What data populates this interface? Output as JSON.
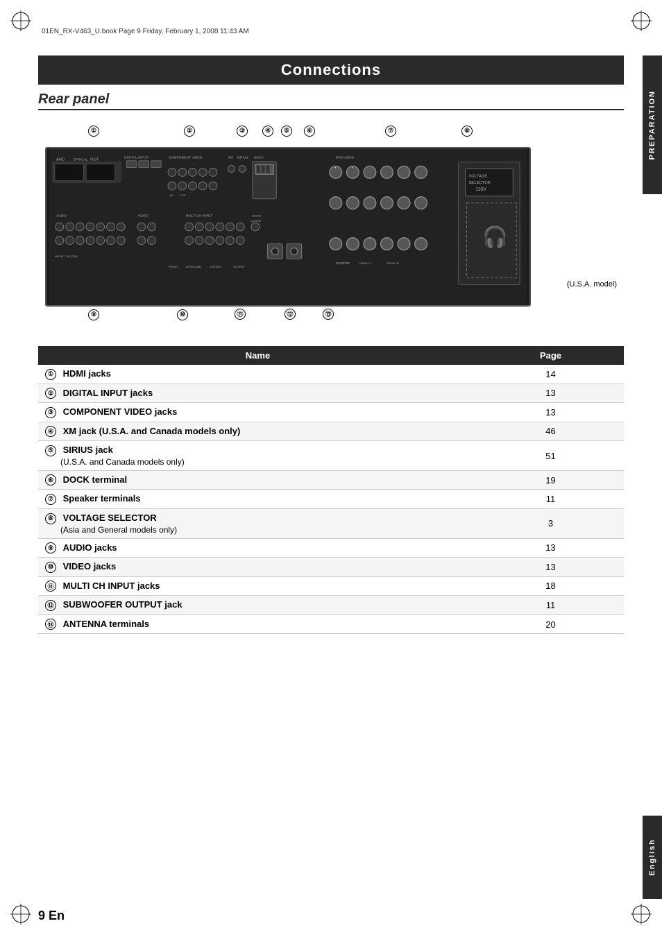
{
  "file_info": "01EN_RX-V463_U.book  Page 9  Friday, February 1, 2008  11:43 AM",
  "title": "Connections",
  "section": "Rear panel",
  "us_model_label": "(U.S.A. model)",
  "page_number": "9 En",
  "preparation_label": "PREPARATION",
  "english_label": "English",
  "table": {
    "col_name": "Name",
    "col_page": "Page",
    "rows": [
      {
        "num": "①",
        "name": "HDMI jacks",
        "page": "14",
        "sub": ""
      },
      {
        "num": "②",
        "name": "DIGITAL INPUT jacks",
        "page": "13",
        "sub": ""
      },
      {
        "num": "③",
        "name": "COMPONENT VIDEO jacks",
        "page": "13",
        "sub": ""
      },
      {
        "num": "④",
        "name": "XM jack (U.S.A. and Canada models only)",
        "page": "46",
        "sub": ""
      },
      {
        "num": "⑤",
        "name": "SIRIUS jack",
        "page": "51",
        "sub": "(U.S.A. and Canada models only)"
      },
      {
        "num": "⑥",
        "name": "DOCK terminal",
        "page": "19",
        "sub": ""
      },
      {
        "num": "⑦",
        "name": "Speaker terminals",
        "page": "11",
        "sub": ""
      },
      {
        "num": "⑧",
        "name": "VOLTAGE SELECTOR",
        "page": "3",
        "sub": "(Asia and General models only)"
      },
      {
        "num": "⑨",
        "name": "AUDIO jacks",
        "page": "13",
        "sub": ""
      },
      {
        "num": "⑩",
        "name": "VIDEO jacks",
        "page": "13",
        "sub": ""
      },
      {
        "num": "⑪",
        "name": "MULTI CH INPUT jacks",
        "page": "18",
        "sub": ""
      },
      {
        "num": "⑫",
        "name": "SUBWOOFER OUTPUT jack",
        "page": "11",
        "sub": ""
      },
      {
        "num": "⑬",
        "name": "ANTENNA terminals",
        "page": "20",
        "sub": ""
      }
    ]
  },
  "callouts": {
    "positions": [
      "①",
      "②",
      "③",
      "④",
      "⑤",
      "⑥",
      "⑦",
      "⑧",
      "⑨",
      "⑩",
      "⑪",
      "⑫",
      "⑬"
    ]
  }
}
